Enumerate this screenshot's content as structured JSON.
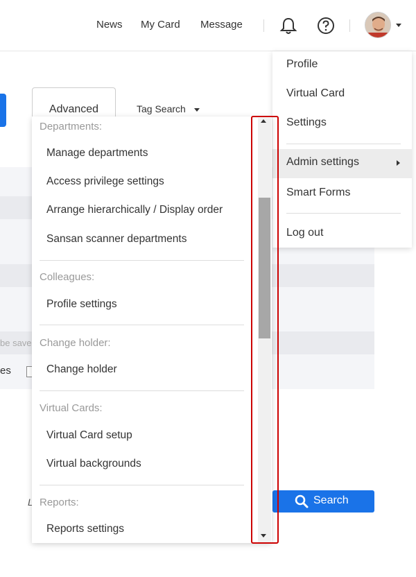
{
  "header": {
    "nav": [
      "News",
      "My Card",
      "Message"
    ]
  },
  "toolbar": {
    "advanced_label": "Advanced",
    "tag_search_label": "Tag Search"
  },
  "background": {
    "partial_text_1": "be save",
    "partial_text_2": "es",
    "partial_letter": "L"
  },
  "search_button": {
    "label": "Search"
  },
  "user_menu": {
    "items": [
      "Profile",
      "Virtual Card",
      "Settings",
      "Admin settings",
      "Smart Forms",
      "Log out"
    ]
  },
  "admin_submenu": {
    "sections": [
      {
        "heading": "Departments:",
        "items": [
          "Manage departments",
          "Access privilege settings",
          "Arrange hierarchically / Display order",
          "Sansan scanner departments"
        ]
      },
      {
        "heading": "Colleagues:",
        "items": [
          "Profile settings"
        ]
      },
      {
        "heading": "Change holder:",
        "items": [
          "Change holder"
        ]
      },
      {
        "heading": "Virtual Cards:",
        "items": [
          "Virtual Card setup",
          "Virtual backgrounds"
        ]
      },
      {
        "heading": "Reports:",
        "items": [
          "Reports settings"
        ]
      }
    ]
  },
  "colors": {
    "accent": "#1a73e8",
    "highlight": "#cc0000"
  }
}
